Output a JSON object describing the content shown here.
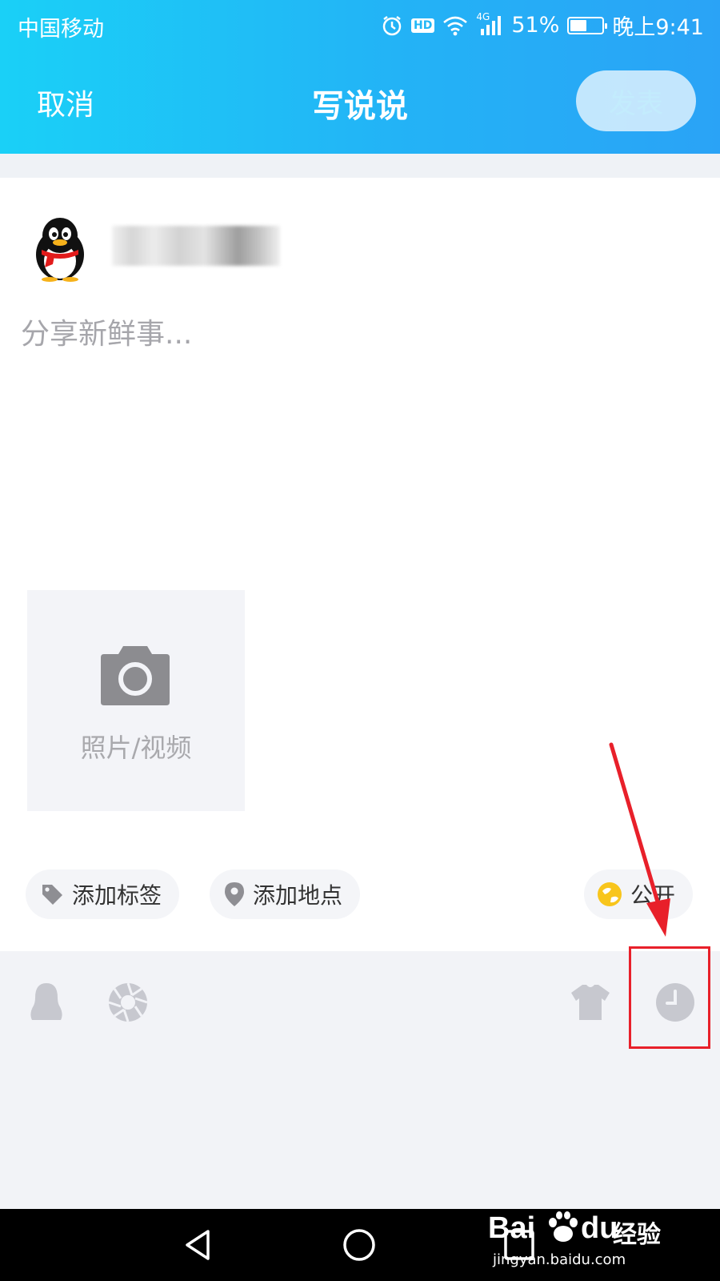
{
  "status_bar": {
    "carrier": "中国移动",
    "hd": "HD",
    "network": "4G",
    "battery_text": "51%",
    "battery_level": 0.51,
    "time": "晚上9:41"
  },
  "nav": {
    "cancel": "取消",
    "title": "写说说",
    "publish": "发表"
  },
  "composer": {
    "placeholder": "分享新鲜事..."
  },
  "media": {
    "label": "照片/视频"
  },
  "chips": {
    "tag": "添加标签",
    "location": "添加地点",
    "privacy": "公开"
  },
  "toolbar": {
    "icons": [
      "penguin-icon",
      "shutter-icon",
      "shirt-icon",
      "clock-icon"
    ]
  },
  "watermark": {
    "brand": "Bai",
    "suffix": "经验",
    "url": "jingyan.baidu.com"
  },
  "colors": {
    "header_start": "#1ad0f7",
    "header_end": "#2aa3f6",
    "annotation_red": "#e8202a",
    "icon_gray": "#c7c8cf"
  }
}
